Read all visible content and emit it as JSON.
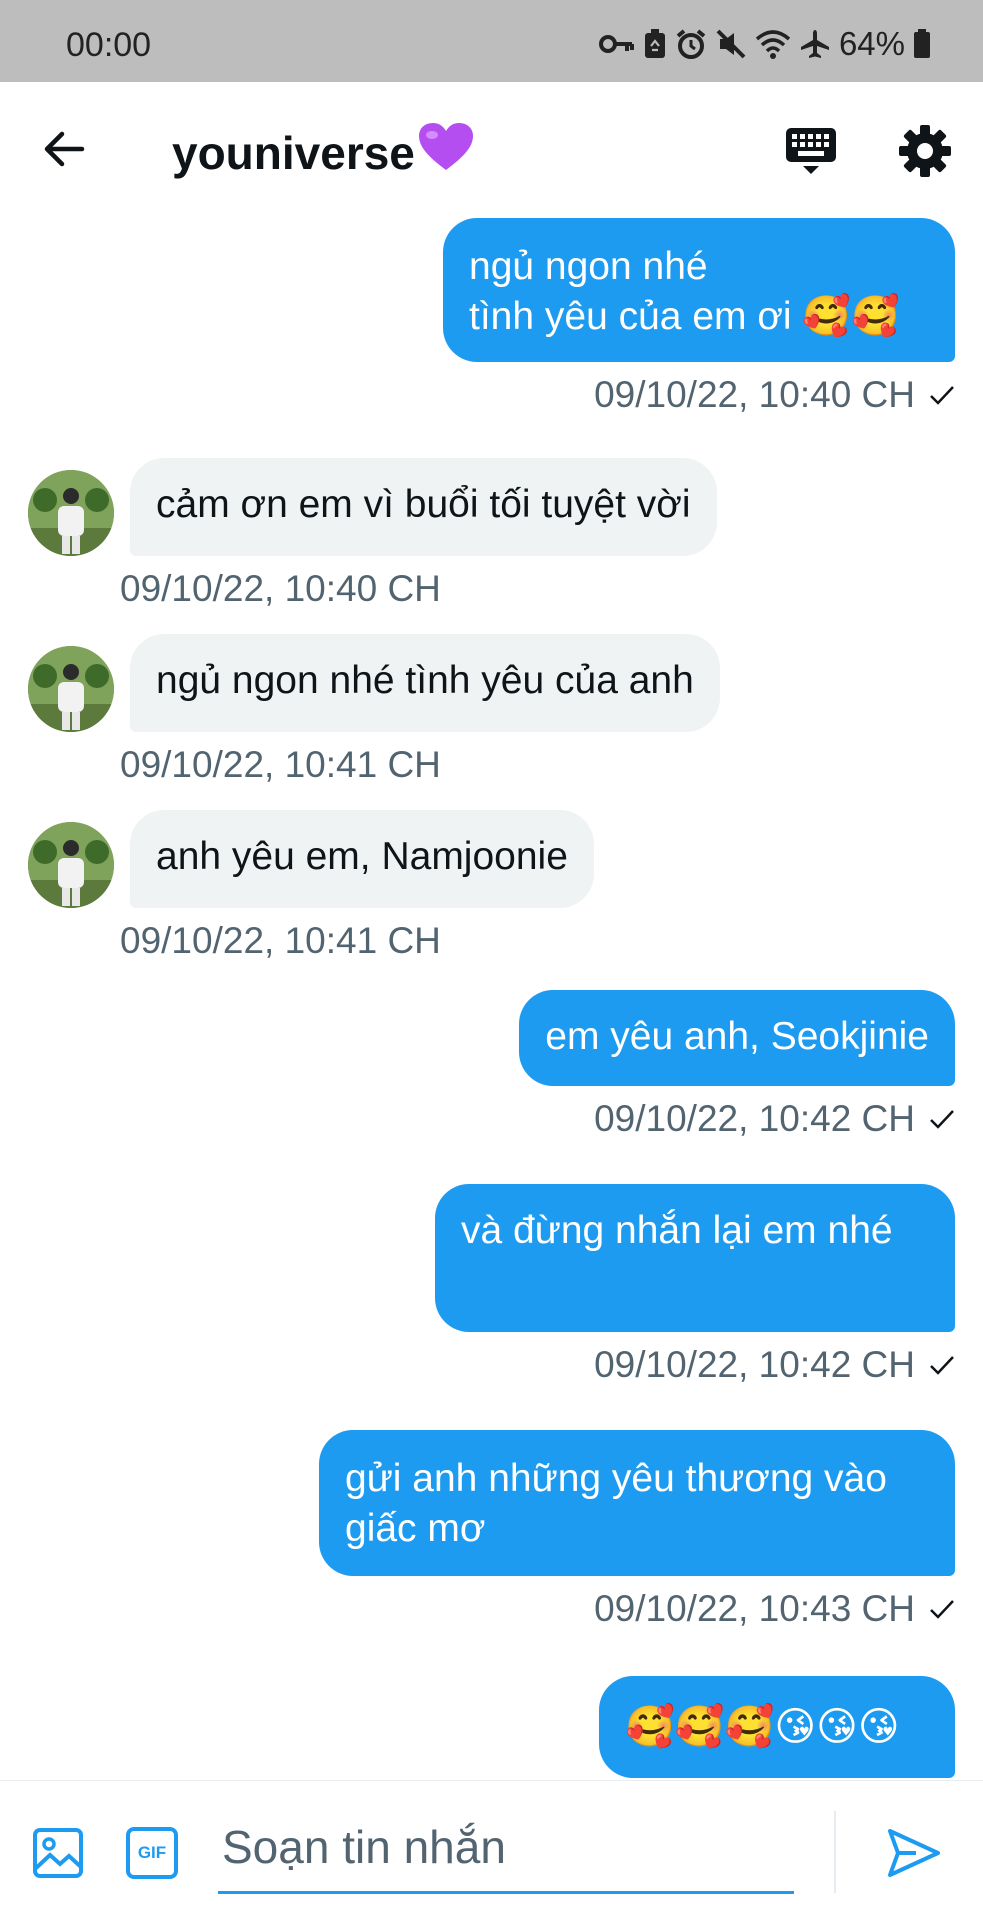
{
  "status_bar": {
    "time": "00:00",
    "battery": "64%",
    "icons": [
      "key-icon",
      "recycle-icon",
      "alarm-icon",
      "mute-icon",
      "wifi-icon",
      "airplane-icon",
      "battery-icon"
    ]
  },
  "header": {
    "title": "youniverse",
    "title_emoji": "💜",
    "back_icon": "arrow-left-icon",
    "keyboard_icon": "keyboard-icon",
    "settings_icon": "gear-icon"
  },
  "messages": [
    {
      "direction": "out",
      "lines": [
        "ngủ ngon nhé",
        "tình yêu của em ơi 🥰🥰"
      ],
      "timestamp": "09/10/22, 10:40 CH",
      "read": true
    },
    {
      "direction": "in",
      "lines": [
        "cảm ơn em vì buổi tối tuyệt vời"
      ],
      "timestamp": "09/10/22, 10:40 CH"
    },
    {
      "direction": "in",
      "lines": [
        "ngủ ngon nhé tình yêu của anh"
      ],
      "timestamp": "09/10/22, 10:41 CH"
    },
    {
      "direction": "in",
      "lines": [
        "anh yêu em, Namjoonie"
      ],
      "timestamp": "09/10/22, 10:41 CH"
    },
    {
      "direction": "out",
      "lines": [
        "em yêu anh, Seokjinie"
      ],
      "timestamp": "09/10/22, 10:42 CH",
      "read": true
    },
    {
      "direction": "out",
      "lines": [
        "và đừng nhắn lại em nhé"
      ],
      "timestamp": "09/10/22, 10:42 CH",
      "read": true
    },
    {
      "direction": "out",
      "lines": [
        "gửi anh những yêu thương vào",
        "giấc mơ"
      ],
      "timestamp": "09/10/22, 10:43 CH",
      "read": true
    },
    {
      "direction": "out",
      "lines": [
        "🥰🥰🥰😘😘😘"
      ]
    }
  ],
  "composer": {
    "placeholder": "Soạn tin nhắn",
    "gif_label": "GIF",
    "media_icon": "image-icon",
    "send_icon": "send-icon"
  },
  "colors": {
    "accent": "#1d9bf0",
    "incoming_bubble": "#eff3f4",
    "timestamp": "#536471",
    "status_bar": "#bdbdbd"
  }
}
